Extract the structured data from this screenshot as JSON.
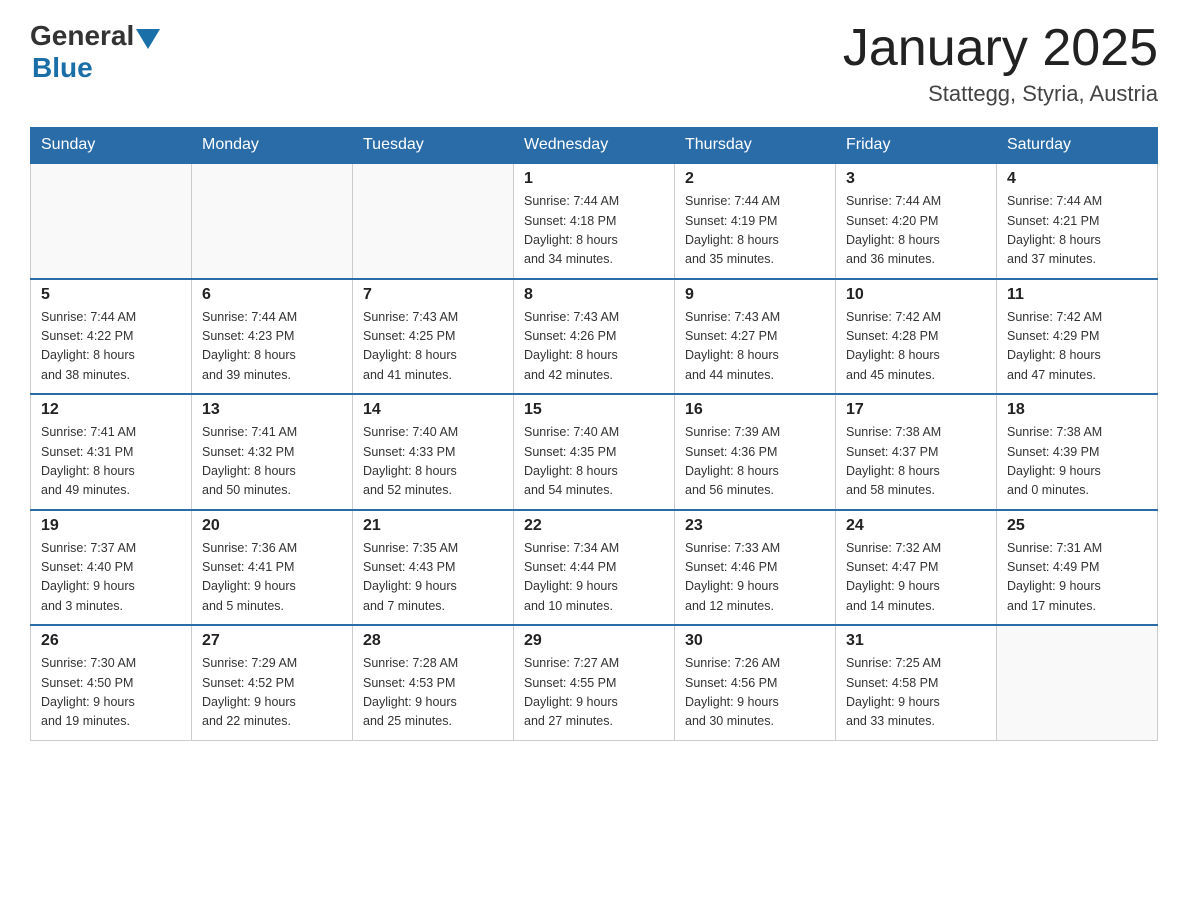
{
  "header": {
    "logo_general": "General",
    "logo_blue": "Blue",
    "month_title": "January 2025",
    "location": "Stattegg, Styria, Austria"
  },
  "days_of_week": [
    "Sunday",
    "Monday",
    "Tuesday",
    "Wednesday",
    "Thursday",
    "Friday",
    "Saturday"
  ],
  "weeks": [
    [
      {
        "day": "",
        "info": ""
      },
      {
        "day": "",
        "info": ""
      },
      {
        "day": "",
        "info": ""
      },
      {
        "day": "1",
        "info": "Sunrise: 7:44 AM\nSunset: 4:18 PM\nDaylight: 8 hours\nand 34 minutes."
      },
      {
        "day": "2",
        "info": "Sunrise: 7:44 AM\nSunset: 4:19 PM\nDaylight: 8 hours\nand 35 minutes."
      },
      {
        "day": "3",
        "info": "Sunrise: 7:44 AM\nSunset: 4:20 PM\nDaylight: 8 hours\nand 36 minutes."
      },
      {
        "day": "4",
        "info": "Sunrise: 7:44 AM\nSunset: 4:21 PM\nDaylight: 8 hours\nand 37 minutes."
      }
    ],
    [
      {
        "day": "5",
        "info": "Sunrise: 7:44 AM\nSunset: 4:22 PM\nDaylight: 8 hours\nand 38 minutes."
      },
      {
        "day": "6",
        "info": "Sunrise: 7:44 AM\nSunset: 4:23 PM\nDaylight: 8 hours\nand 39 minutes."
      },
      {
        "day": "7",
        "info": "Sunrise: 7:43 AM\nSunset: 4:25 PM\nDaylight: 8 hours\nand 41 minutes."
      },
      {
        "day": "8",
        "info": "Sunrise: 7:43 AM\nSunset: 4:26 PM\nDaylight: 8 hours\nand 42 minutes."
      },
      {
        "day": "9",
        "info": "Sunrise: 7:43 AM\nSunset: 4:27 PM\nDaylight: 8 hours\nand 44 minutes."
      },
      {
        "day": "10",
        "info": "Sunrise: 7:42 AM\nSunset: 4:28 PM\nDaylight: 8 hours\nand 45 minutes."
      },
      {
        "day": "11",
        "info": "Sunrise: 7:42 AM\nSunset: 4:29 PM\nDaylight: 8 hours\nand 47 minutes."
      }
    ],
    [
      {
        "day": "12",
        "info": "Sunrise: 7:41 AM\nSunset: 4:31 PM\nDaylight: 8 hours\nand 49 minutes."
      },
      {
        "day": "13",
        "info": "Sunrise: 7:41 AM\nSunset: 4:32 PM\nDaylight: 8 hours\nand 50 minutes."
      },
      {
        "day": "14",
        "info": "Sunrise: 7:40 AM\nSunset: 4:33 PM\nDaylight: 8 hours\nand 52 minutes."
      },
      {
        "day": "15",
        "info": "Sunrise: 7:40 AM\nSunset: 4:35 PM\nDaylight: 8 hours\nand 54 minutes."
      },
      {
        "day": "16",
        "info": "Sunrise: 7:39 AM\nSunset: 4:36 PM\nDaylight: 8 hours\nand 56 minutes."
      },
      {
        "day": "17",
        "info": "Sunrise: 7:38 AM\nSunset: 4:37 PM\nDaylight: 8 hours\nand 58 minutes."
      },
      {
        "day": "18",
        "info": "Sunrise: 7:38 AM\nSunset: 4:39 PM\nDaylight: 9 hours\nand 0 minutes."
      }
    ],
    [
      {
        "day": "19",
        "info": "Sunrise: 7:37 AM\nSunset: 4:40 PM\nDaylight: 9 hours\nand 3 minutes."
      },
      {
        "day": "20",
        "info": "Sunrise: 7:36 AM\nSunset: 4:41 PM\nDaylight: 9 hours\nand 5 minutes."
      },
      {
        "day": "21",
        "info": "Sunrise: 7:35 AM\nSunset: 4:43 PM\nDaylight: 9 hours\nand 7 minutes."
      },
      {
        "day": "22",
        "info": "Sunrise: 7:34 AM\nSunset: 4:44 PM\nDaylight: 9 hours\nand 10 minutes."
      },
      {
        "day": "23",
        "info": "Sunrise: 7:33 AM\nSunset: 4:46 PM\nDaylight: 9 hours\nand 12 minutes."
      },
      {
        "day": "24",
        "info": "Sunrise: 7:32 AM\nSunset: 4:47 PM\nDaylight: 9 hours\nand 14 minutes."
      },
      {
        "day": "25",
        "info": "Sunrise: 7:31 AM\nSunset: 4:49 PM\nDaylight: 9 hours\nand 17 minutes."
      }
    ],
    [
      {
        "day": "26",
        "info": "Sunrise: 7:30 AM\nSunset: 4:50 PM\nDaylight: 9 hours\nand 19 minutes."
      },
      {
        "day": "27",
        "info": "Sunrise: 7:29 AM\nSunset: 4:52 PM\nDaylight: 9 hours\nand 22 minutes."
      },
      {
        "day": "28",
        "info": "Sunrise: 7:28 AM\nSunset: 4:53 PM\nDaylight: 9 hours\nand 25 minutes."
      },
      {
        "day": "29",
        "info": "Sunrise: 7:27 AM\nSunset: 4:55 PM\nDaylight: 9 hours\nand 27 minutes."
      },
      {
        "day": "30",
        "info": "Sunrise: 7:26 AM\nSunset: 4:56 PM\nDaylight: 9 hours\nand 30 minutes."
      },
      {
        "day": "31",
        "info": "Sunrise: 7:25 AM\nSunset: 4:58 PM\nDaylight: 9 hours\nand 33 minutes."
      },
      {
        "day": "",
        "info": ""
      }
    ]
  ]
}
